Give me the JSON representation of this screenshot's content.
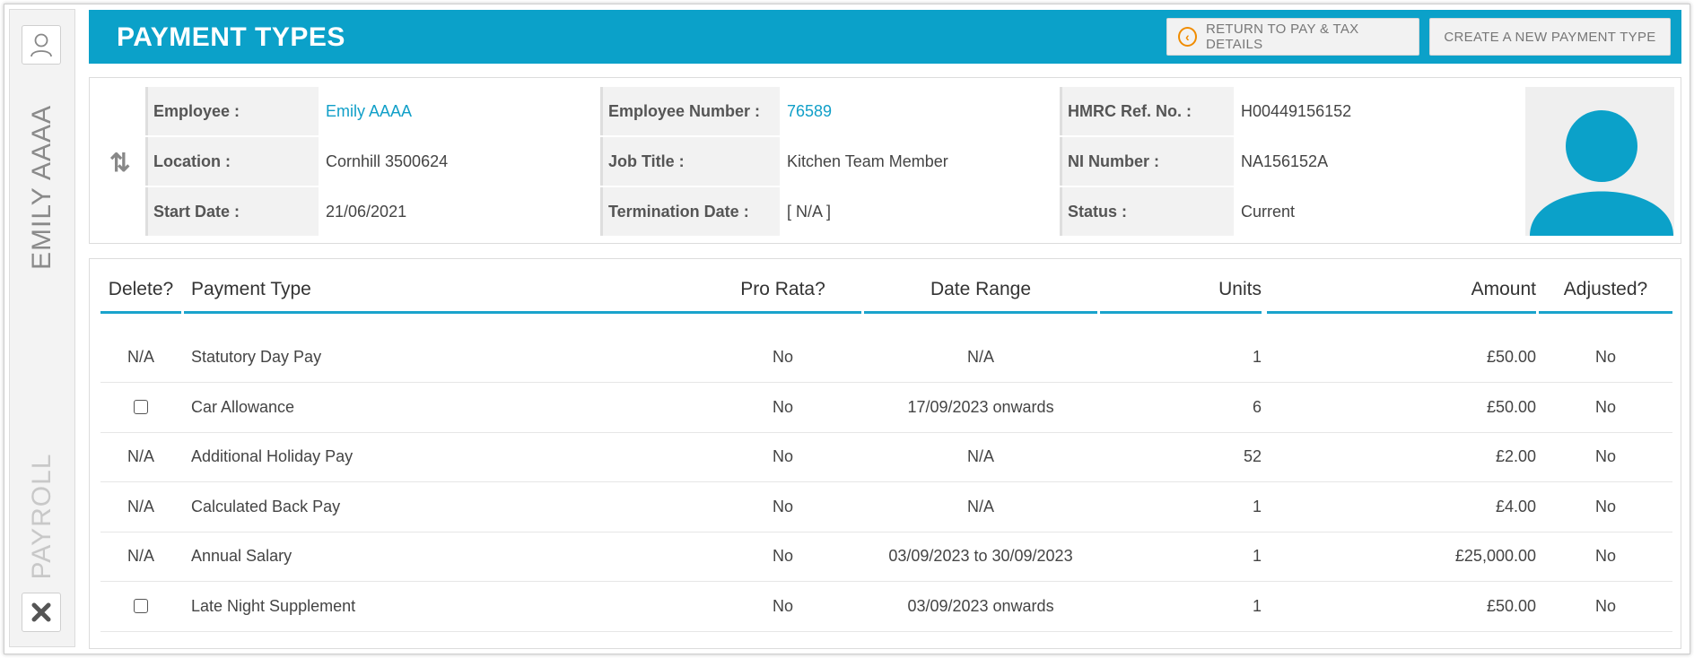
{
  "sidebar": {
    "employee_name": "EMILY AAAA",
    "section": "PAYROLL",
    "user_icon": "user-icon",
    "close_icon": "close-icon"
  },
  "header": {
    "title": "PAYMENT TYPES",
    "return_label": "RETURN TO PAY & TAX DETAILS",
    "create_label": "CREATE A NEW PAYMENT TYPE",
    "accent": "#0ba1c9"
  },
  "employee": {
    "employee_label": "Employee :",
    "employee_value": "Emily AAAA",
    "number_label": "Employee Number :",
    "number_value": "76589",
    "hmrc_label": "HMRC Ref. No. :",
    "hmrc_value": "H00449156152",
    "location_label": "Location :",
    "location_value": "Cornhill 3500624",
    "job_label": "Job Title :",
    "job_value": "Kitchen Team Member",
    "ni_label": "NI Number :",
    "ni_value": "NA156152A",
    "start_label": "Start Date :",
    "start_value": "21/06/2021",
    "term_label": "Termination Date :",
    "term_value": "[ N/A ]",
    "status_label": "Status :",
    "status_value": "Current"
  },
  "table": {
    "headers": {
      "delete": "Delete?",
      "type": "Payment Type",
      "prorata": "Pro Rata?",
      "range": "Date Range",
      "units": "Units",
      "amount": "Amount",
      "adjusted": "Adjusted?"
    },
    "rows": [
      {
        "delete": "N/A",
        "checkbox": false,
        "type": "Statutory Day Pay",
        "prorata": "No",
        "range": "N/A",
        "units": "1",
        "amount": "£50.00",
        "adjusted": "No"
      },
      {
        "delete": "",
        "checkbox": true,
        "type": "Car Allowance",
        "prorata": "No",
        "range": "17/09/2023 onwards",
        "units": "6",
        "amount": "£50.00",
        "adjusted": "No"
      },
      {
        "delete": "N/A",
        "checkbox": false,
        "type": "Additional Holiday Pay",
        "prorata": "No",
        "range": "N/A",
        "units": "52",
        "amount": "£2.00",
        "adjusted": "No"
      },
      {
        "delete": "N/A",
        "checkbox": false,
        "type": "Calculated Back Pay",
        "prorata": "No",
        "range": "N/A",
        "units": "1",
        "amount": "£4.00",
        "adjusted": "No"
      },
      {
        "delete": "N/A",
        "checkbox": false,
        "type": "Annual Salary",
        "prorata": "No",
        "range": "03/09/2023 to 30/09/2023",
        "units": "1",
        "amount": "£25,000.00",
        "adjusted": "No"
      },
      {
        "delete": "",
        "checkbox": true,
        "type": "Late Night Supplement",
        "prorata": "No",
        "range": "03/09/2023 onwards",
        "units": "1",
        "amount": "£50.00",
        "adjusted": "No"
      }
    ]
  }
}
